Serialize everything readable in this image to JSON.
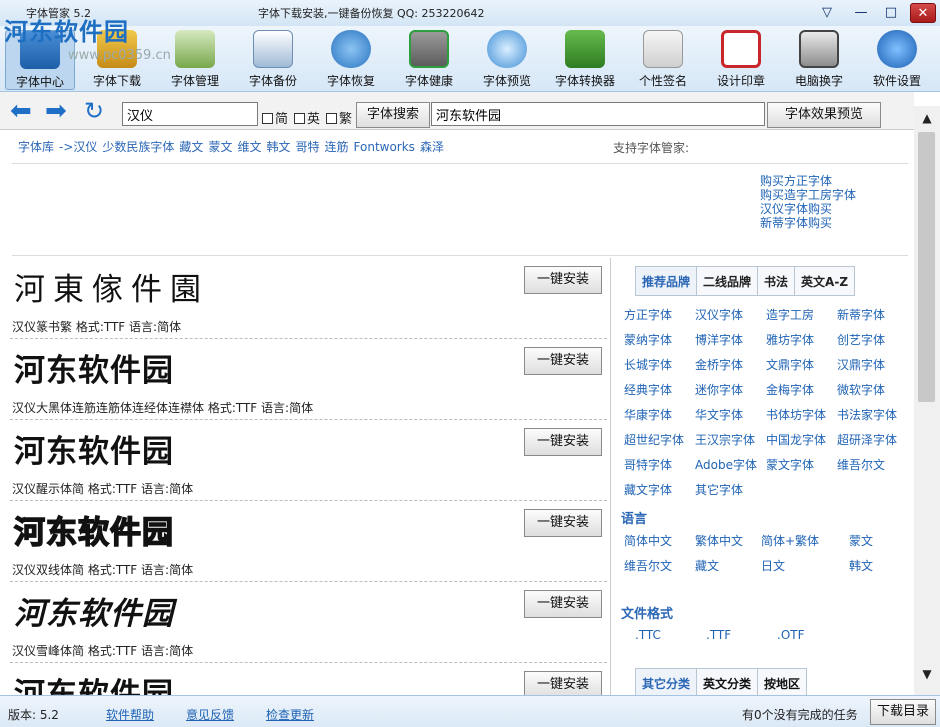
{
  "title_bar": {
    "app": "字体管家 5.2",
    "slogan": "字体下载安装,一键备份恢复 QQ: 253220642",
    "controls": [
      "▽",
      "—",
      "□",
      "✕"
    ]
  },
  "watermark": {
    "logo": "河东软件园",
    "url": "www.pc0359.cn"
  },
  "toolbar": [
    {
      "label": "字体中心",
      "icon": "font-center-icon"
    },
    {
      "label": "字体下载",
      "icon": "font-download-icon"
    },
    {
      "label": "字体管理",
      "icon": "font-manage-icon"
    },
    {
      "label": "字体备份",
      "icon": "font-backup-icon"
    },
    {
      "label": "字体恢复",
      "icon": "font-restore-icon"
    },
    {
      "label": "字体健康",
      "icon": "font-health-icon"
    },
    {
      "label": "字体预览",
      "icon": "font-preview-icon"
    },
    {
      "label": "字体转换器",
      "icon": "font-converter-icon"
    },
    {
      "label": "个性签名",
      "icon": "signature-icon"
    },
    {
      "label": "设计印章",
      "icon": "seal-icon"
    },
    {
      "label": "电脑换字",
      "icon": "pc-font-icon"
    },
    {
      "label": "软件设置",
      "icon": "settings-icon"
    }
  ],
  "search": {
    "value": "汉仪",
    "simplified": "简",
    "english": "英",
    "traditional": "繁",
    "button": "字体搜索",
    "preview_value": "河东软件园",
    "preview_button": "字体效果预览"
  },
  "breadcrumb": [
    "字体库",
    "->汉仪",
    "少数民族字体",
    "藏文",
    "蒙文",
    "维文",
    "韩文",
    "哥特",
    "连筋",
    "Fontworks",
    "森泽"
  ],
  "support_label": "支持字体管家:",
  "buy_links": [
    "购买方正字体",
    "购买造字工房字体",
    "汉仪字体购买",
    "新蒂字体购买"
  ],
  "fonts": [
    {
      "preview": "河東傢件園",
      "info": "汉仪篆书繁 格式:TTF 语言:简体"
    },
    {
      "preview": "河东软件园",
      "info": "汉仪大黑体连筋连筋体连经体连襟体 格式:TTF 语言:简体"
    },
    {
      "preview": "河东软件园",
      "info": "汉仪醒示体简 格式:TTF 语言:简体"
    },
    {
      "preview": "河东软件园",
      "info": "汉仪双线体简 格式:TTF 语言:简体"
    },
    {
      "preview": "河东软件园",
      "info": "汉仪雪峰体简 格式:TTF 语言:简体"
    },
    {
      "preview": "河东软件园",
      "info": ""
    }
  ],
  "install_label": "一键安装",
  "right_tabs": [
    "推荐品牌",
    "二线品牌",
    "书法",
    "英文A-Z"
  ],
  "brands": [
    "方正字体",
    "汉仪字体",
    "造字工房",
    "新蒂字体",
    "蒙纳字体",
    "博洋字体",
    "雅坊字体",
    "创艺字体",
    "长城字体",
    "金桥字体",
    "文鼎字体",
    "汉鼎字体",
    "经典字体",
    "迷你字体",
    "金梅字体",
    "微软字体",
    "华康字体",
    "华文字体",
    "书体坊字体",
    "书法家字体",
    "超世纪字体",
    "王汉宗字体",
    "中国龙字体",
    "超研泽字体",
    "哥特字体",
    "Adobe字体",
    "蒙文字体",
    "维吾尔文",
    "藏文字体",
    "其它字体"
  ],
  "lang_heading": "语言",
  "languages": [
    "简体中文",
    "繁体中文",
    "简体+繁体",
    "蒙文",
    "维吾尔文",
    "藏文",
    "日文",
    "韩文"
  ],
  "format_heading": "文件格式",
  "formats": [
    ".TTC",
    ".TTF",
    ".OTF"
  ],
  "bottom_tabs": [
    "其它分类",
    "英文分类",
    "按地区"
  ],
  "status": {
    "version": "版本: 5.2",
    "help": "软件帮助",
    "feedback": "意见反馈",
    "update": "检查更新",
    "tasks": "有0个没有完成的任务",
    "download_dir": "下载目录"
  }
}
